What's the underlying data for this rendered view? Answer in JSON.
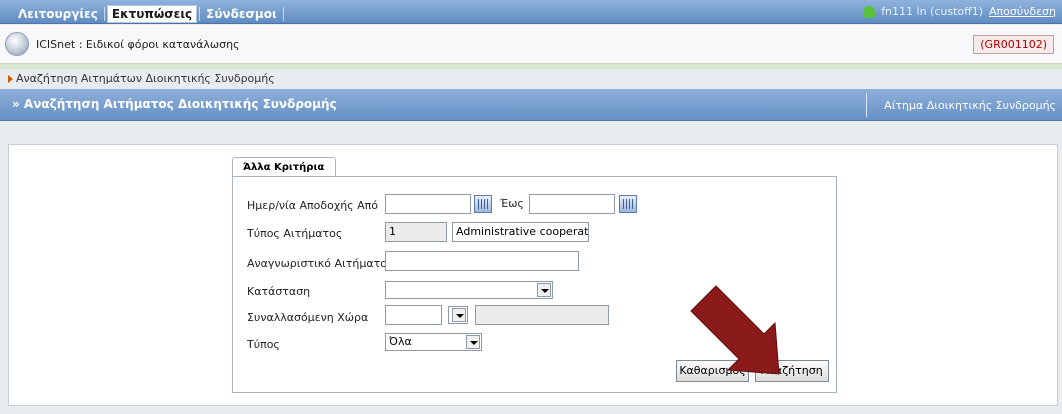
{
  "topnav": {
    "menu": [
      "Λειτουργίες",
      "Εκτυπώσεις",
      "Σύνδεσμοι"
    ],
    "active_index": 1,
    "user": "fn111 ln (custoff1)",
    "logout": "Αποσύνδεση"
  },
  "app": {
    "title": "ICISnet : Ειδικοί φόροι κατανάλωσης",
    "code": "(GR001102)"
  },
  "breadcrumb": "Αναζήτηση Αιτημάτων Διοικητικής Συνδρομής",
  "section": {
    "title": "» Αναζήτηση Αιτήματος Διοικητικής Συνδρομής",
    "right_link": "Αίτημα Διοικητικής Συνδρομής"
  },
  "form": {
    "tab": "Άλλα Κριτήρια",
    "date_from_label": "Ημερ/νία Αποδοχής Από",
    "date_from_value": "",
    "date_to_label": "Έως",
    "date_to_value": "",
    "type_label": "Τύπος Αιτήματος",
    "type_code": "1",
    "type_desc": "Administrative cooperatic",
    "id_label": "Αναγνωριστικό Αιτήματος",
    "id_value": "",
    "status_label": "Κατάσταση",
    "status_value": "",
    "country_label": "Συναλλασόμενη Χώρα",
    "country_code": "",
    "country_name": "",
    "kind_label": "Τύπος",
    "kind_value": "Όλα",
    "clear_button": "Καθαρισμός",
    "search_button": "Αναζήτηση"
  },
  "colors": {
    "accent": "#6591c6",
    "code_red": "#b40000",
    "arrow": "#8b1a1a"
  }
}
